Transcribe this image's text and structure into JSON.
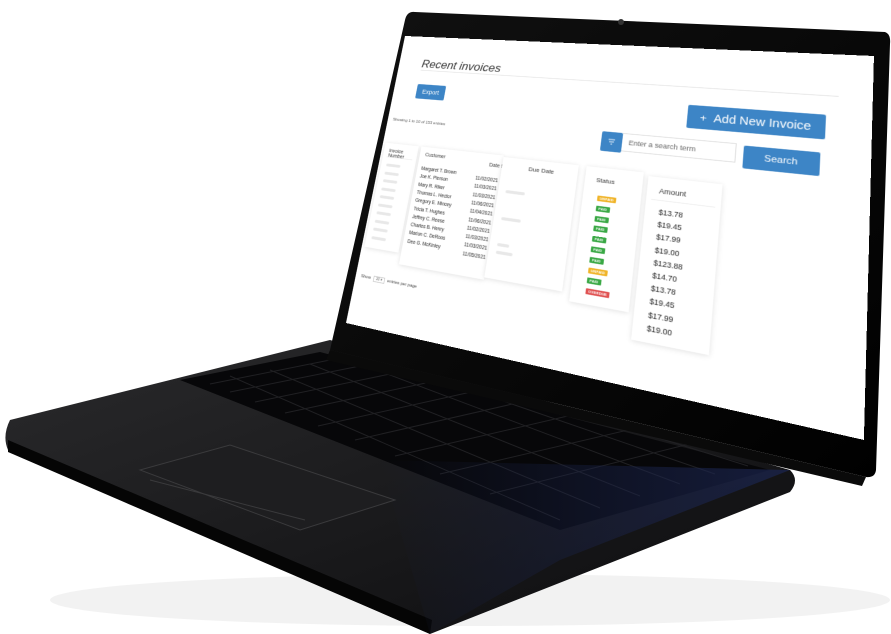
{
  "page": {
    "title": "Recent invoices"
  },
  "toolbar": {
    "export_label": "Export",
    "add_icon": "+",
    "add_label": "Add New Invoice"
  },
  "list_info": {
    "showing_text": "Showing 1 to 10 of 153 entries"
  },
  "search": {
    "filter_icon": "filter-icon",
    "placeholder": "Enter a search term",
    "button_label": "Search"
  },
  "table": {
    "headers": {
      "invoice_number": "Invoice Number",
      "customer": "Customer",
      "date_sent": "Date Sent",
      "due_date": "Due Date",
      "status": "Status",
      "amount": "Amount"
    },
    "rows": [
      {
        "customer": "Margaret T. Brown",
        "date": "11/02/2021",
        "time": "2:40 PM",
        "status": "UNPAID",
        "amount": "$13.78"
      },
      {
        "customer": "Joe K. Pierson",
        "date": "11/03/2021",
        "time": "1:17 PM",
        "status": "PAID",
        "amount": "$19.45"
      },
      {
        "customer": "Mary R. Riker",
        "date": "11/03/2021",
        "time": "9:55 PM",
        "status": "PAID",
        "amount": "$17.99"
      },
      {
        "customer": "Thomas L. Hector",
        "date": "11/06/2021",
        "time": "4:56 PM",
        "status": "PAID",
        "amount": "$19.00"
      },
      {
        "customer": "Gregory E. Mincey",
        "date": "11/04/2021",
        "time": "2:40 PM",
        "status": "PAID",
        "amount": "$123.88"
      },
      {
        "customer": "Tricia T. Hughes",
        "date": "11/06/2021",
        "time": "2:40 PM",
        "status": "PAID",
        "amount": "$14.70"
      },
      {
        "customer": "Jeffrey C. Reese",
        "date": "11/02/2021",
        "time": "2:40 PM",
        "status": "PAID",
        "amount": "$13.78"
      },
      {
        "customer": "Charles B. Henry",
        "date": "11/03/2021",
        "time": "1:17 PM",
        "status": "UNPAID",
        "amount": "$19.45"
      },
      {
        "customer": "Marion C. DeRoos",
        "date": "11/03/2021",
        "time": "9:55 PM",
        "status": "PAID",
        "amount": "$17.99"
      },
      {
        "customer": "Dee G. McKinley",
        "date": "11/05/2021",
        "time": "4:56 PM",
        "status": "OVERDUE",
        "amount": "$19.00"
      }
    ]
  },
  "pagination": {
    "show_label": "Show",
    "per_page_value": "10",
    "suffix_label": "entries per page"
  },
  "colors": {
    "primary": "#3d85c6",
    "paid": "#3aa845",
    "unpaid": "#f0b429",
    "overdue": "#e05252",
    "laptop_body": "#1c1c1e"
  }
}
